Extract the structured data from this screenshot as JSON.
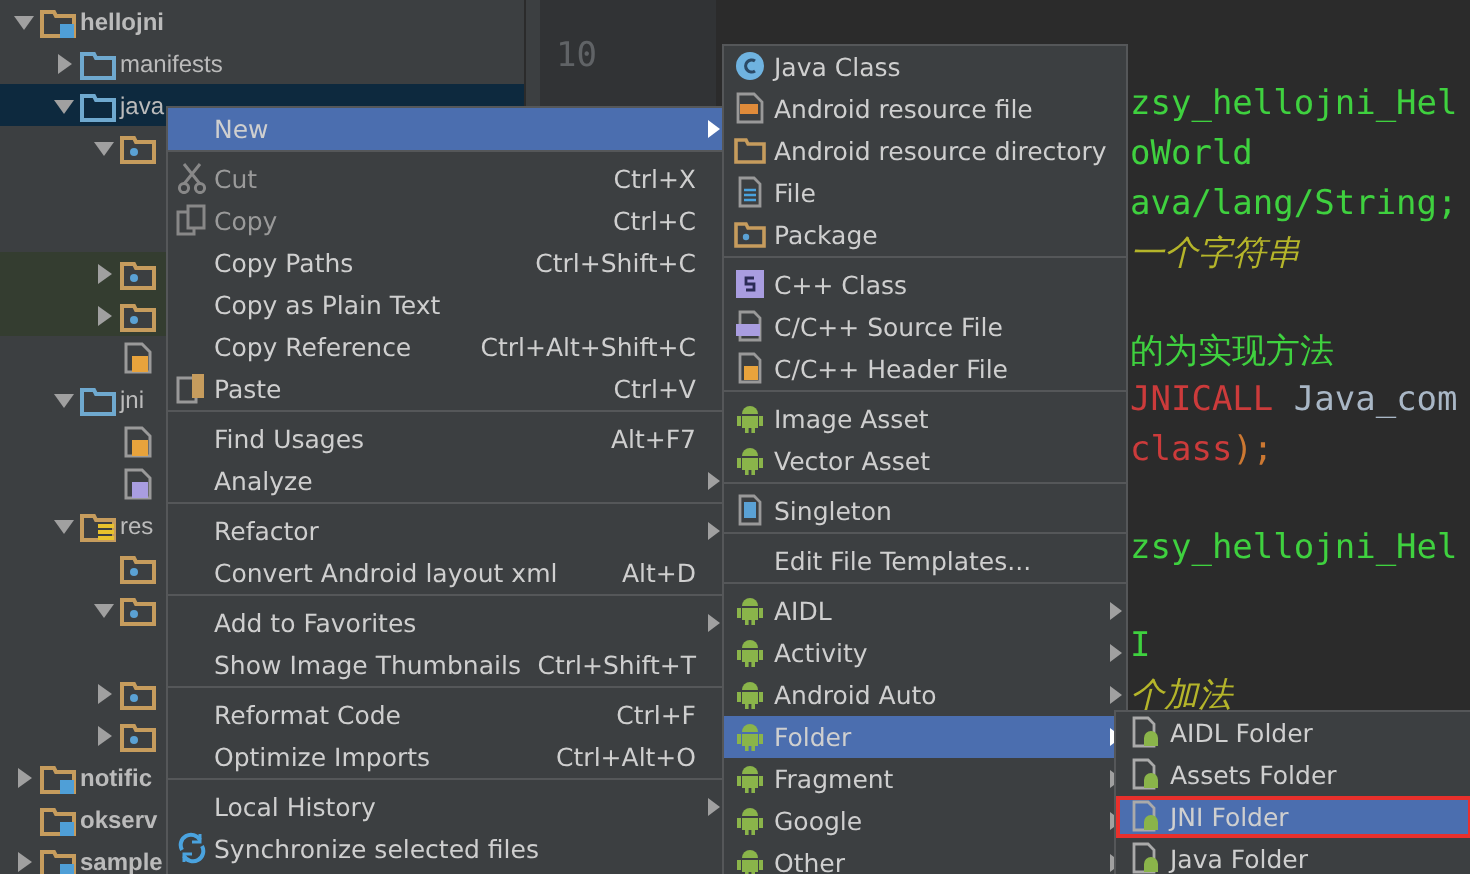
{
  "tree": [
    {
      "label": "hellojni",
      "kind": "module",
      "expanded": true,
      "children": [
        {
          "label": "manifests",
          "kind": "folder",
          "expanded": false
        },
        {
          "label": "java",
          "kind": "folder",
          "expanded": true,
          "selected": true,
          "children": [
            {
              "kind": "package",
              "expanded": true,
              "children": [
                {
                  "kind": "covered"
                },
                {
                  "kind": "covered"
                }
              ]
            },
            {
              "kind": "package",
              "expanded": false,
              "tinted": true
            },
            {
              "kind": "package",
              "expanded": false,
              "tinted": true
            },
            {
              "kind": "header"
            }
          ]
        },
        {
          "label": "jni",
          "kind": "folder",
          "expanded": true,
          "children": [
            {
              "kind": "header"
            },
            {
              "kind": "cfile"
            }
          ]
        },
        {
          "label": "res",
          "kind": "resfolder",
          "expanded": true,
          "children": [
            {
              "kind": "package"
            },
            {
              "kind": "package",
              "expanded": true,
              "children": [
                {
                  "kind": "covered"
                }
              ]
            },
            {
              "kind": "package",
              "expanded": false
            },
            {
              "kind": "package",
              "expanded": false
            }
          ]
        }
      ]
    },
    {
      "label": "notific",
      "kind": "module",
      "expanded": false
    },
    {
      "label": "okserv",
      "kind": "module"
    },
    {
      "label": "sample",
      "kind": "module",
      "expanded": false
    }
  ],
  "editor": {
    "line_number": "10",
    "blocks": [
      [
        [
          {
            "text": "zsy_hellojni_Hel",
            "kind": "macro"
          }
        ],
        [
          {
            "text": "oWorld",
            "kind": "macro"
          }
        ],
        [
          {
            "text": "ava/lang/String;",
            "kind": "macro"
          }
        ],
        [
          {
            "text": "一个字符串",
            "kind": "comment"
          }
        ]
      ],
      [
        [
          {
            "text": "的为实现方法",
            "kind": "macro"
          }
        ],
        [
          {
            "text": "JNICALL",
            "kind": "keyword"
          },
          {
            "text": " Java_com",
            "kind": "plain"
          }
        ],
        [
          {
            "text": "class",
            "kind": "keyword"
          },
          {
            "text": ");",
            "kind": "punct"
          }
        ]
      ],
      [
        [
          {
            "text": "zsy_hellojni_Hel",
            "kind": "macro"
          }
        ]
      ],
      [
        [
          {
            "text": "I",
            "kind": "macro"
          }
        ],
        [
          {
            "text": "个加法",
            "kind": "comment"
          }
        ]
      ]
    ]
  },
  "context_menu": [
    {
      "kind": "plain",
      "label": "New",
      "submenu": true,
      "selected": true
    },
    {
      "kind": "separator"
    },
    {
      "kind": "cut",
      "label": "Cut",
      "shortcut": "Ctrl+X",
      "disabled": true
    },
    {
      "kind": "copy",
      "label": "Copy",
      "shortcut": "Ctrl+C",
      "disabled": true
    },
    {
      "kind": "plain",
      "label": "Copy Paths",
      "shortcut": "Ctrl+Shift+C"
    },
    {
      "kind": "plain",
      "label": "Copy as Plain Text"
    },
    {
      "kind": "plain",
      "label": "Copy Reference",
      "shortcut": "Ctrl+Alt+Shift+C"
    },
    {
      "kind": "paste",
      "label": "Paste",
      "shortcut": "Ctrl+V"
    },
    {
      "kind": "separator"
    },
    {
      "kind": "plain",
      "label": "Find Usages",
      "shortcut": "Alt+F7"
    },
    {
      "kind": "plain",
      "label": "Analyze",
      "submenu": true
    },
    {
      "kind": "separator"
    },
    {
      "kind": "plain",
      "label": "Refactor",
      "submenu": true
    },
    {
      "kind": "plain",
      "label": "Convert Android layout xml",
      "shortcut": "Alt+D"
    },
    {
      "kind": "separator"
    },
    {
      "kind": "plain",
      "label": "Add to Favorites",
      "submenu": true
    },
    {
      "kind": "plain",
      "label": "Show Image Thumbnails",
      "shortcut": "Ctrl+Shift+T"
    },
    {
      "kind": "separator"
    },
    {
      "kind": "plain",
      "label": "Reformat Code",
      "shortcut": "Ctrl+F"
    },
    {
      "kind": "plain",
      "label": "Optimize Imports",
      "shortcut": "Ctrl+Alt+O"
    },
    {
      "kind": "separator"
    },
    {
      "kind": "plain",
      "label": "Local History",
      "submenu": true
    },
    {
      "kind": "sync",
      "label": "Synchronize selected files"
    }
  ],
  "new_menu": [
    {
      "kind": "class",
      "label": "Java Class"
    },
    {
      "kind": "resfile",
      "label": "Android resource file"
    },
    {
      "kind": "folder",
      "label": "Android resource directory"
    },
    {
      "kind": "file",
      "label": "File"
    },
    {
      "kind": "package",
      "label": "Package"
    },
    {
      "kind": "separator"
    },
    {
      "kind": "cppclass",
      "label": "C++ Class"
    },
    {
      "kind": "cppsource",
      "label": "C/C++ Source File"
    },
    {
      "kind": "cppheader",
      "label": "C/C++ Header File"
    },
    {
      "kind": "separator"
    },
    {
      "kind": "android",
      "label": "Image Asset"
    },
    {
      "kind": "android",
      "label": "Vector Asset"
    },
    {
      "kind": "separator"
    },
    {
      "kind": "singleton",
      "label": "Singleton"
    },
    {
      "kind": "separator"
    },
    {
      "kind": "plain",
      "label": "Edit File Templates..."
    },
    {
      "kind": "separator"
    },
    {
      "kind": "android",
      "label": "AIDL",
      "submenu": true
    },
    {
      "kind": "android",
      "label": "Activity",
      "submenu": true
    },
    {
      "kind": "android",
      "label": "Android Auto",
      "submenu": true
    },
    {
      "kind": "android",
      "label": "Folder",
      "submenu": true,
      "selected": true
    },
    {
      "kind": "android",
      "label": "Fragment",
      "submenu": true
    },
    {
      "kind": "android",
      "label": "Google",
      "submenu": true
    },
    {
      "kind": "android",
      "label": "Other",
      "submenu": true
    }
  ],
  "folder_menu": [
    {
      "kind": "androidfile",
      "label": "AIDL Folder",
      "selected": false
    },
    {
      "kind": "androidfile",
      "label": "Assets Folder",
      "selected": false
    },
    {
      "kind": "androidfile",
      "label": "JNI Folder",
      "selected": true,
      "outlined": true
    },
    {
      "kind": "androidfile",
      "label": "Java Folder",
      "selected": false
    }
  ]
}
